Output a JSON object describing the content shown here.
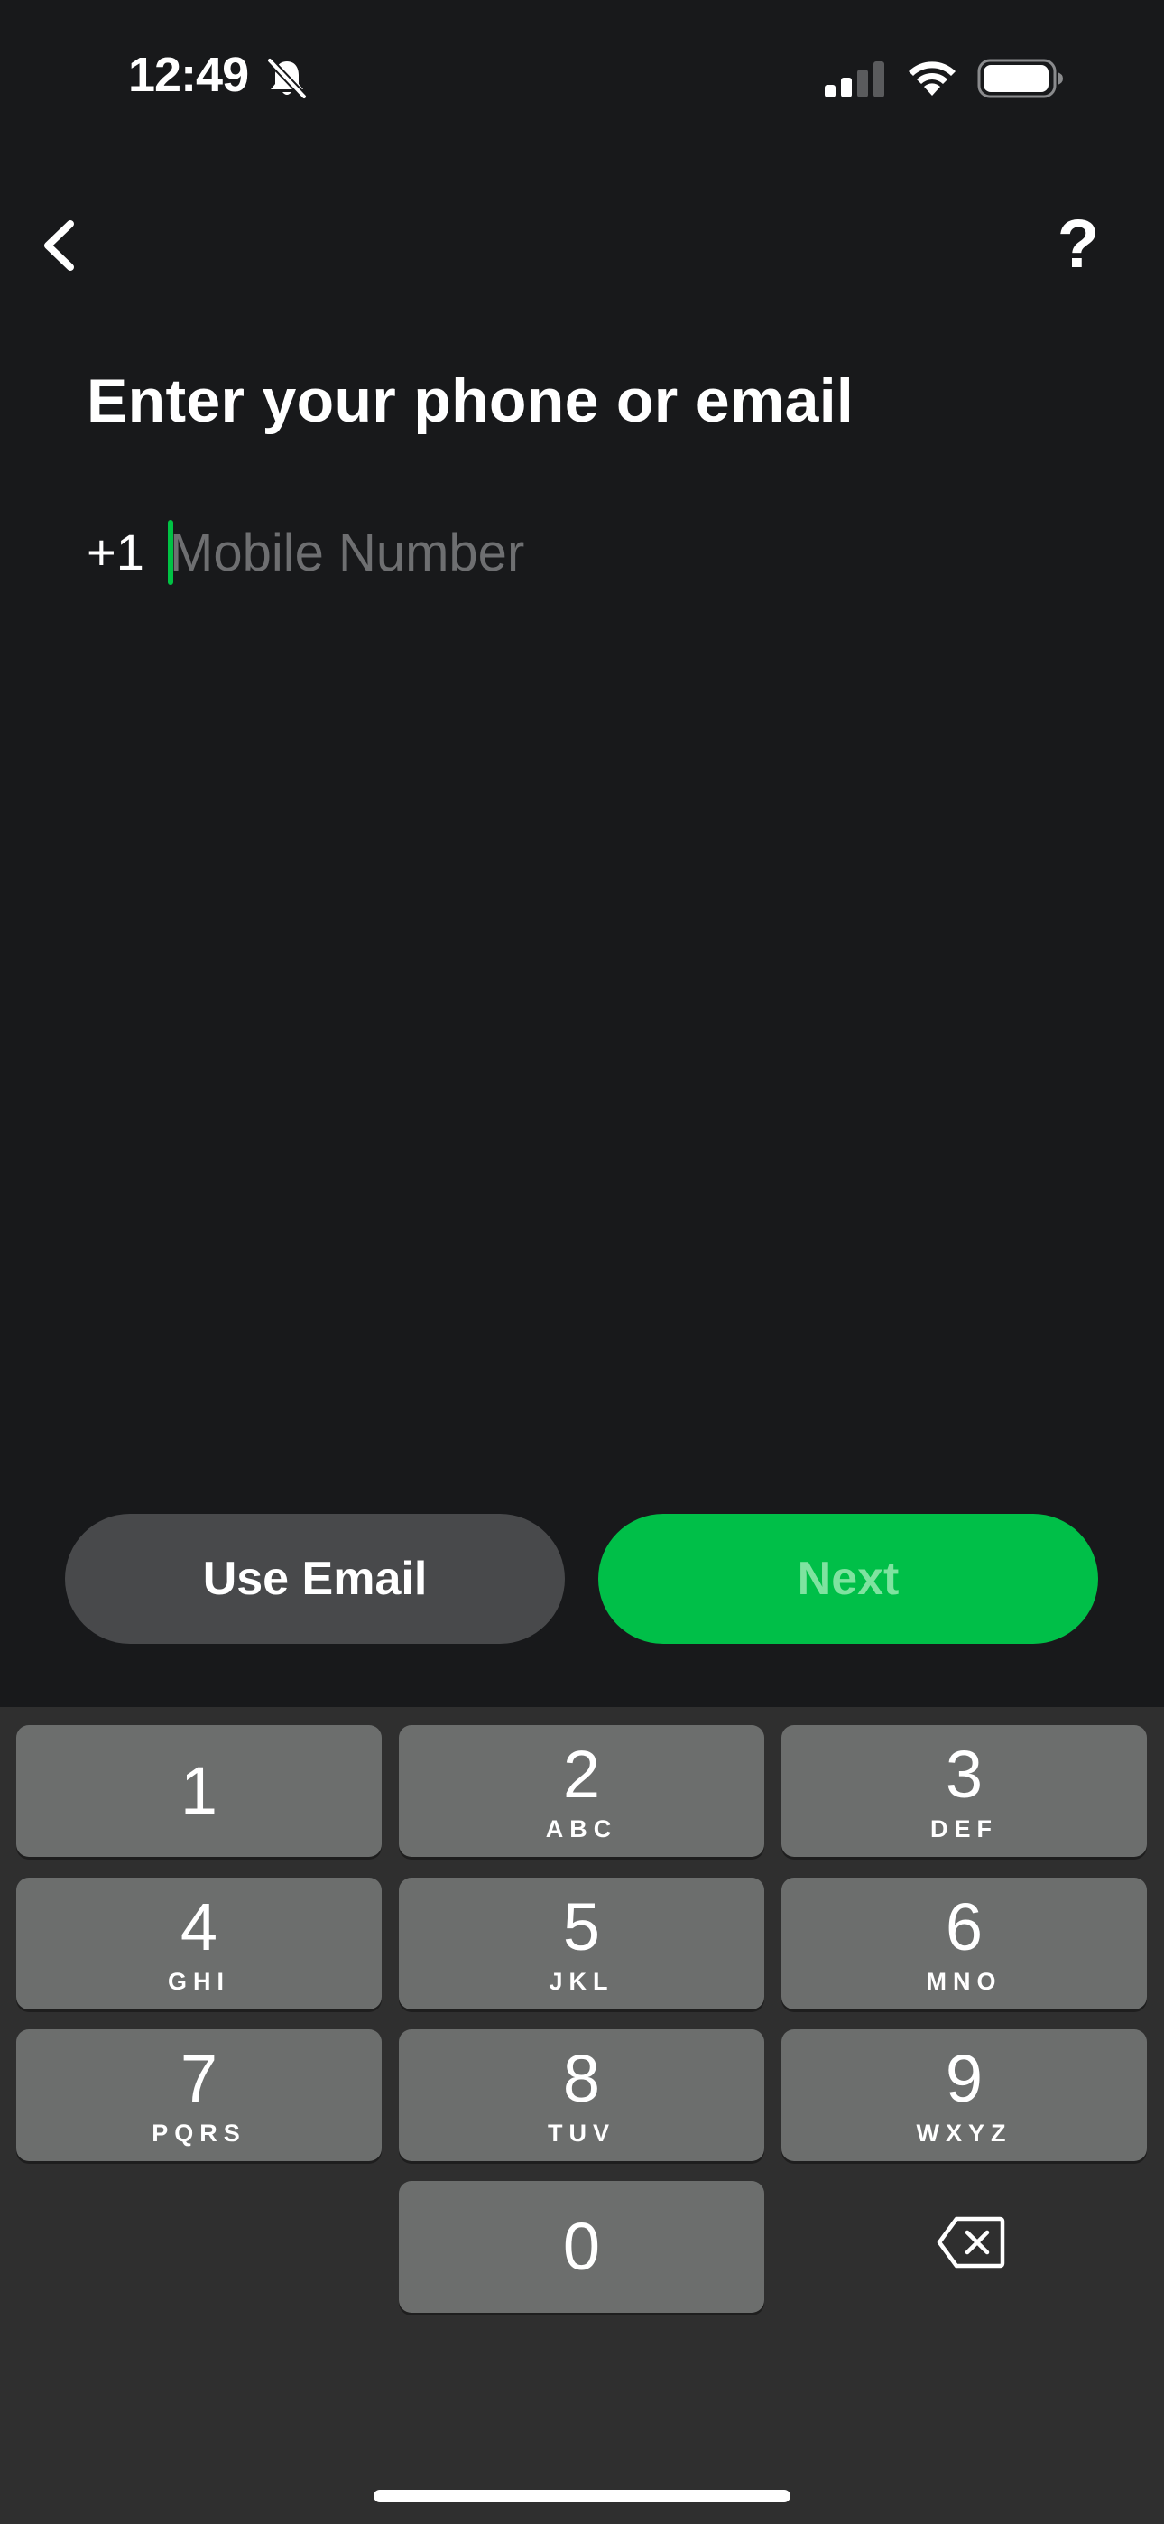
{
  "status_bar": {
    "time": "12:49",
    "icons": [
      "bell-slash-icon",
      "cellular-signal-icon",
      "wifi-icon",
      "battery-icon"
    ]
  },
  "nav": {
    "back_icon": "chevron-left-icon",
    "help_label": "?"
  },
  "page": {
    "title": "Enter your phone or email"
  },
  "phone_field": {
    "country_code": "+1",
    "value": "",
    "placeholder": "Mobile Number"
  },
  "actions": {
    "use_email_label": "Use Email",
    "next_label": "Next"
  },
  "keypad": {
    "keys": [
      {
        "digit": "1",
        "letters": ""
      },
      {
        "digit": "2",
        "letters": "ABC"
      },
      {
        "digit": "3",
        "letters": "DEF"
      },
      {
        "digit": "4",
        "letters": "GHI"
      },
      {
        "digit": "5",
        "letters": "JKL"
      },
      {
        "digit": "6",
        "letters": "MNO"
      },
      {
        "digit": "7",
        "letters": "PQRS"
      },
      {
        "digit": "8",
        "letters": "TUV"
      },
      {
        "digit": "9",
        "letters": "WXYZ"
      },
      {
        "digit": "0",
        "letters": ""
      }
    ],
    "delete_icon": "backspace-icon"
  },
  "colors": {
    "background": "#18191b",
    "accent_green": "#00bf48",
    "caret_green": "#00c244",
    "secondary_button": "#48494b",
    "keypad_background": "#2f2f2f",
    "key_background": "#6c6e6d"
  }
}
